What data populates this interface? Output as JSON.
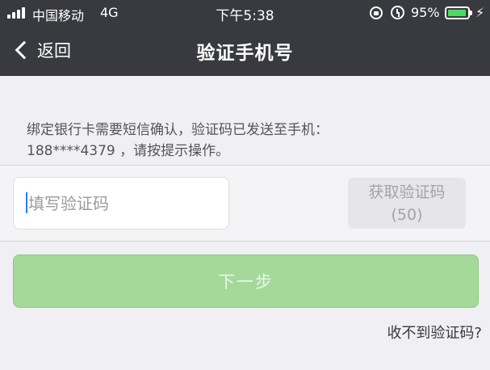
{
  "status_bar": {
    "carrier": "中国移动",
    "network": "4G",
    "time": "下午5:38",
    "battery_pct": "95%",
    "battery_level": 0.95,
    "icons": [
      "signal-icon",
      "rotation-lock-icon",
      "alarm-icon",
      "battery-icon",
      "charging-icon"
    ]
  },
  "nav": {
    "back_label": "返回",
    "title": "验证手机号"
  },
  "notice": {
    "line1": "绑定银行卡需要短信确认，验证码已发送至手机：",
    "line2": "188****4379 ，请按提示操作。"
  },
  "code": {
    "placeholder": "填写验证码",
    "value": "",
    "get_code_label": "获取验证码",
    "countdown": "(50)"
  },
  "actions": {
    "next_label": "下一步",
    "no_code_label": "收不到验证码?"
  },
  "colors": {
    "nav_bg": "#393a3f",
    "page_bg": "#efeff4",
    "primary_disabled": "#a4d99a",
    "battery_green": "#4cd964"
  }
}
